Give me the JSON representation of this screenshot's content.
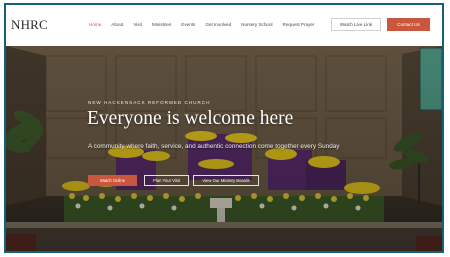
{
  "header": {
    "logo": "NHRC",
    "nav": [
      "Home",
      "About",
      "Visit",
      "Ministries",
      "Events",
      "Get Involved",
      "Nursery School",
      "Request Prayer"
    ],
    "active_nav": "Home",
    "watch_label": "Watch Live Link",
    "contact_label": "Contact Us"
  },
  "hero": {
    "kicker": "NEW HACKENSACK REFORMED CHURCH",
    "headline": "Everyone is welcome here",
    "subtitle": "A community where faith, service, and authentic connection come together every Sunday",
    "buttons": {
      "watch": "Watch Online",
      "visit": "Plan Your Visit",
      "ministry": "View Our Ministry Boards"
    }
  },
  "colors": {
    "accent": "#c9573e",
    "frame": "#17607a",
    "purple_drape": "#5a2d6e",
    "daffodil": "#e8c81c"
  }
}
